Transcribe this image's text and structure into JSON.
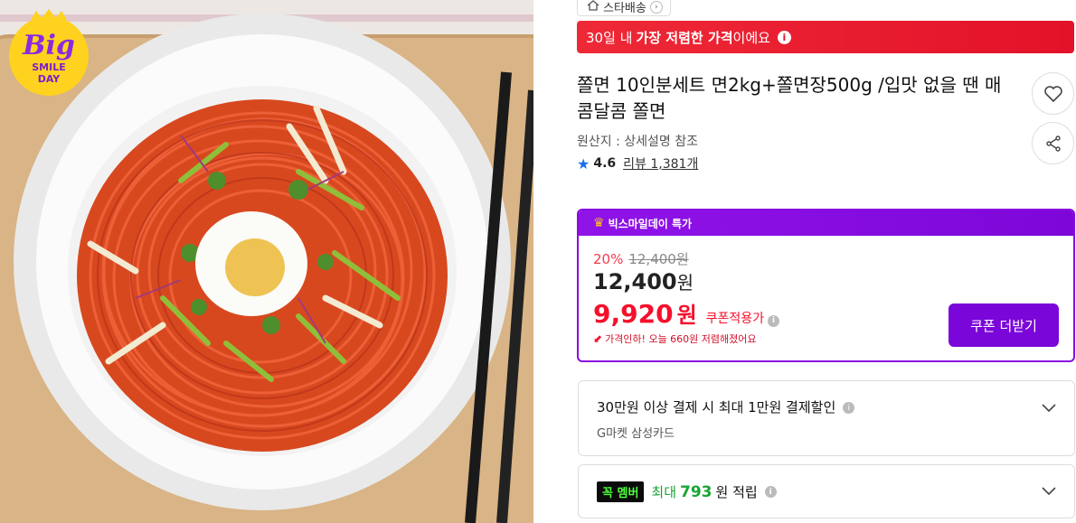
{
  "badge": {
    "line1": "Big",
    "line2": "SMILE",
    "line3": "DAY"
  },
  "shipping": {
    "label": "스타배송"
  },
  "banner": {
    "pre": "30일 내",
    "bold": "가장 저렴한 가격",
    "post": "이에요"
  },
  "product": {
    "title": "쫄면 10인분세트 면2kg+쫄면장500g /입맛 없을 땐 매콤달콤 쫄면",
    "origin": "원산지 : 상세설명 참조",
    "rating": "4.6",
    "reviews": "리뷰 1,381개"
  },
  "deal": {
    "header": "빅스마일데이 특가",
    "discount": "20%",
    "original_price": "12,400원",
    "price_num": "12,400",
    "price_unit": "원",
    "coupon_price_num": "9,920",
    "coupon_price_unit": "원",
    "coupon_label": "쿠폰적용가",
    "price_cut": "가격인하! 오늘 660원 저렴해졌어요",
    "coupon_button": "쿠폰 더받기"
  },
  "payment": {
    "title": "30만원 이상 결제 시 최대 1만원 결제할인",
    "sub": "G마켓 삼성카드"
  },
  "membership": {
    "logo": "꼭 멤버",
    "pre": "최대",
    "amount": "793",
    "post": "원 적립"
  },
  "colors": {
    "accent_red": "#e3122a",
    "accent_purple": "#7a06d9",
    "star_blue": "#1a6fe8",
    "member_green": "#18a534"
  }
}
